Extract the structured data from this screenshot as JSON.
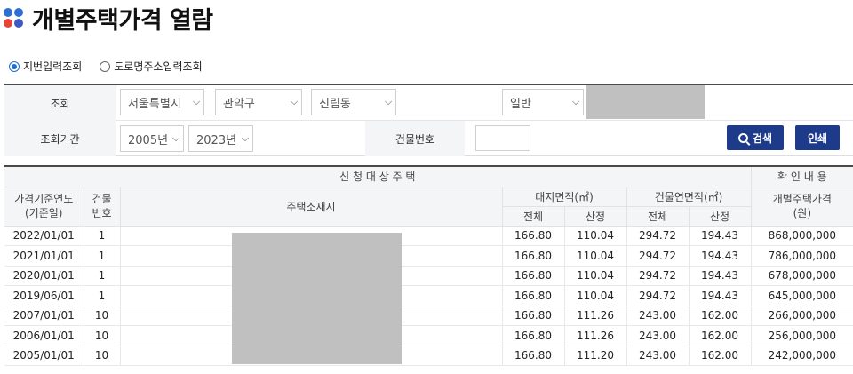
{
  "page": {
    "title": "개별주택가격 열람"
  },
  "search_type": {
    "options": [
      {
        "label": "지번입력조회",
        "checked": true
      },
      {
        "label": "도로명주소입력조회",
        "checked": false
      }
    ]
  },
  "search": {
    "row1_label": "조회",
    "city": "서울특별시",
    "district": "관악구",
    "dong": "신림동",
    "land_type": "일반",
    "row2_label": "조회기간",
    "year_from": "2005년",
    "year_to": "2023년",
    "building_no_label": "건물번호",
    "building_no_value": "",
    "search_button": "검색",
    "print_button": "인쇄"
  },
  "table": {
    "group_header_target": "신 청 대 상 주 택",
    "group_header_confirm": "확 인 내 용",
    "col_base_date": "가격기준연도\n(기준일)",
    "col_building_no": "건물\n번호",
    "col_address": "주택소재지",
    "col_land_area": "대지면적(㎡)",
    "col_floor_area": "건물연면적(㎡)",
    "col_price": "개별주택가격\n(원)",
    "sub_total": "전체",
    "sub_calc": "산정",
    "rows": [
      {
        "date": "2022/01/01",
        "bno": "1",
        "land_total": "166.80",
        "land_calc": "110.04",
        "floor_total": "294.72",
        "floor_calc": "194.43",
        "price": "868,000,000"
      },
      {
        "date": "2021/01/01",
        "bno": "1",
        "land_total": "166.80",
        "land_calc": "110.04",
        "floor_total": "294.72",
        "floor_calc": "194.43",
        "price": "786,000,000"
      },
      {
        "date": "2020/01/01",
        "bno": "1",
        "land_total": "166.80",
        "land_calc": "110.04",
        "floor_total": "294.72",
        "floor_calc": "194.43",
        "price": "678,000,000"
      },
      {
        "date": "2019/06/01",
        "bno": "1",
        "land_total": "166.80",
        "land_calc": "110.04",
        "floor_total": "294.72",
        "floor_calc": "194.43",
        "price": "645,000,000"
      },
      {
        "date": "2007/01/01",
        "bno": "10",
        "land_total": "166.80",
        "land_calc": "111.26",
        "floor_total": "243.00",
        "floor_calc": "162.00",
        "price": "266,000,000"
      },
      {
        "date": "2006/01/01",
        "bno": "10",
        "land_total": "166.80",
        "land_calc": "111.26",
        "floor_total": "243.00",
        "floor_calc": "162.00",
        "price": "256,000,000"
      },
      {
        "date": "2005/01/01",
        "bno": "10",
        "land_total": "166.80",
        "land_calc": "111.20",
        "floor_total": "243.00",
        "floor_calc": "162.00",
        "price": "242,000,000"
      }
    ]
  },
  "icons": {
    "logo": "four-dots-icon",
    "search": "search-icon",
    "dropdown": "chevron-down-icon"
  },
  "colors": {
    "primary_button": "#1e3a8a",
    "accent_blue": "#2e6fd4",
    "accent_red": "#e8433a"
  }
}
